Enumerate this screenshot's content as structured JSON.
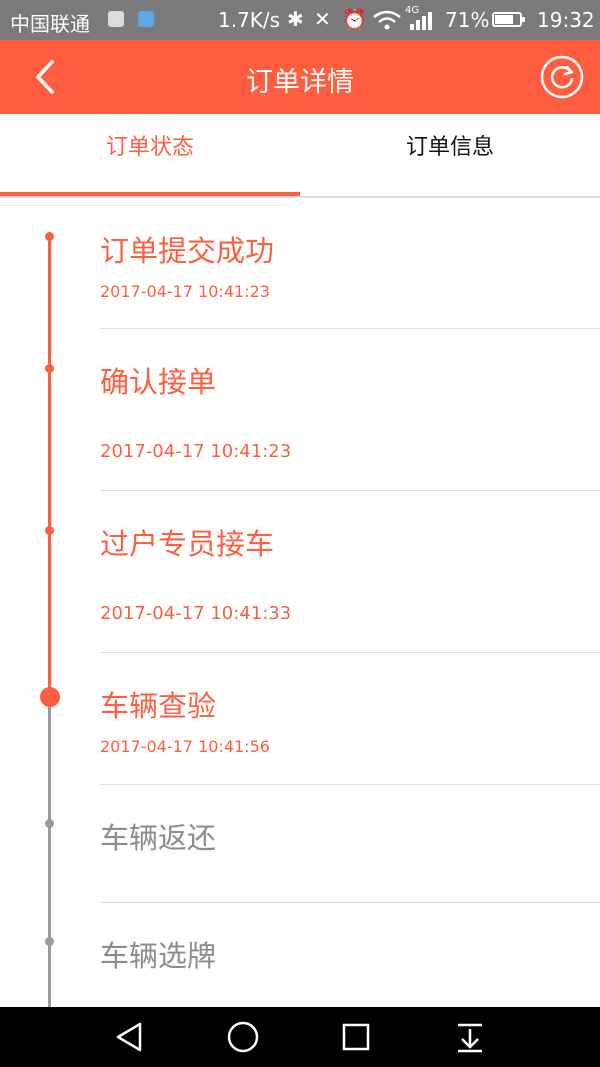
{
  "status_bar": {
    "carrier": "中国联通",
    "net_speed": "1.7K/s",
    "network_type": "4G",
    "battery": "71%",
    "time": "19:32",
    "icons": [
      "gallery-icon",
      "message-icon",
      "bluetooth-icon",
      "silent-icon",
      "alarm-icon",
      "wifi-icon",
      "signal-icon",
      "battery-icon"
    ]
  },
  "header": {
    "title": "订单详情",
    "back_icon": "chevron-left-icon",
    "refresh_icon": "refresh-icon",
    "accent_color": "#ff5f40"
  },
  "tabs": [
    {
      "label": "订单状态",
      "active": true
    },
    {
      "label": "订单信息",
      "active": false
    }
  ],
  "timeline": {
    "completed_color": "#ff5f40",
    "pending_color": "#8c8c8c",
    "steps": [
      {
        "title": "订单提交成功",
        "time": "2017-04-17 10:41:23",
        "status": "done"
      },
      {
        "title": "确认接单",
        "time": "2017-04-17 10:41:23",
        "status": "done"
      },
      {
        "title": "过户专员接车",
        "time": "2017-04-17 10:41:33",
        "status": "done"
      },
      {
        "title": "车辆查验",
        "time": "2017-04-17 10:41:56",
        "status": "current"
      },
      {
        "title": "车辆返还",
        "time": "",
        "status": "pending"
      },
      {
        "title": "车辆选牌",
        "time": "",
        "status": "pending"
      }
    ]
  },
  "nav_bar": {
    "icons": [
      "back-triangle-icon",
      "home-circle-icon",
      "recents-square-icon",
      "notification-pull-icon"
    ]
  }
}
